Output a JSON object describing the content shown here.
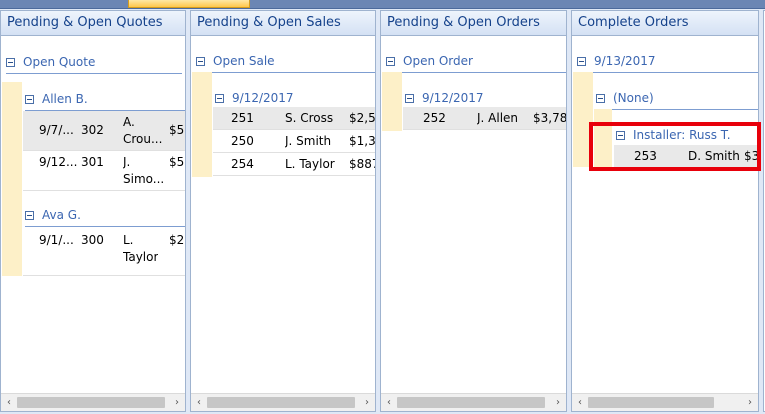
{
  "panels": [
    {
      "title": "Pending & Open Quotes",
      "groups": {
        "g1": "Open Quote",
        "g2": "Allen B.",
        "g3": "Ava G."
      },
      "rows": [
        {
          "date": "9/7/...",
          "num": "302",
          "name1": "A.",
          "name2": "Crou...",
          "amt": "$5,"
        },
        {
          "date": "9/12...",
          "num": "301",
          "name1": "J.",
          "name2": "Simo...",
          "amt": "$5,"
        },
        {
          "date": "9/1/...",
          "num": "300",
          "name1": "L.",
          "name2": "Taylor",
          "amt": "$2,"
        }
      ]
    },
    {
      "title": "Pending & Open Sales",
      "groups": {
        "g1": "Open Sale",
        "g2": "9/12/2017"
      },
      "rows": [
        {
          "num": "251",
          "name": "S. Cross",
          "amt": "$2,54"
        },
        {
          "num": "250",
          "name": "J. Smith",
          "amt": "$1,31"
        },
        {
          "num": "254",
          "name": "L. Taylor",
          "amt": "$887"
        }
      ]
    },
    {
      "title": "Pending & Open Orders",
      "groups": {
        "g1": "Open Order",
        "g2": "9/12/2017"
      },
      "rows": [
        {
          "num": "252",
          "name": "J. Allen",
          "amt": "$3,78"
        }
      ]
    },
    {
      "title": "Complete Orders",
      "groups": {
        "g1": "9/13/2017",
        "g2": "(None)",
        "g3": "Installer: Russ T."
      },
      "rows": [
        {
          "num": "253",
          "name": "D. Smith",
          "amt": "$3"
        }
      ]
    }
  ],
  "scroll": {
    "left": "‹",
    "right": "›"
  },
  "colors": {
    "highlight": "#e8000b",
    "group_text": "#3b66b1",
    "stripe": "#fdf0c8"
  }
}
